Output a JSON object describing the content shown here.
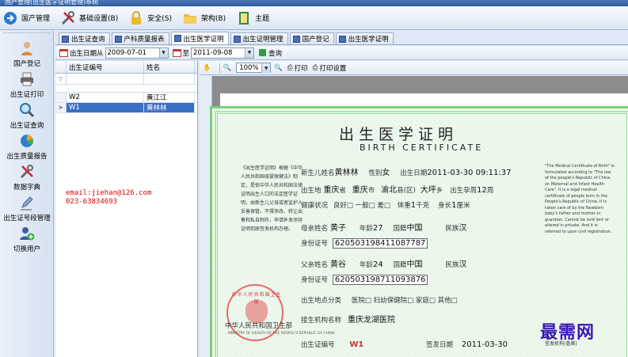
{
  "window": {
    "title": "国产管理(出生医学证明管理)系统"
  },
  "toolbar": [
    {
      "label": "国产管理",
      "icon": "arrow-circle-icon"
    },
    {
      "label": "基础设置(B)",
      "icon": "tools-icon"
    },
    {
      "label": "安全(S)",
      "icon": "padlock-icon"
    },
    {
      "label": "架构(B)",
      "icon": "folder-icon"
    },
    {
      "label": "主题",
      "icon": "theme-book-icon"
    }
  ],
  "sidebar": [
    {
      "label": "国产登记",
      "icon": "baby-icon"
    },
    {
      "label": "出生证打印",
      "icon": "printer-icon"
    },
    {
      "label": "出生证查询",
      "icon": "magnifier-icon"
    },
    {
      "label": "出生质量报告",
      "icon": "pie-chart-icon"
    },
    {
      "label": "数据字典",
      "icon": "tools-icon"
    },
    {
      "label": "出生证号段管理",
      "icon": "pen-icon"
    },
    {
      "label": "切换用户",
      "icon": "user-add-icon"
    }
  ],
  "tabs": [
    {
      "label": "出生证查询",
      "active": false
    },
    {
      "label": "产科质量报表",
      "active": false
    },
    {
      "label": "出生医学证明",
      "active": true
    },
    {
      "label": "出生证明管理",
      "active": false
    },
    {
      "label": "国产登记",
      "active": false
    },
    {
      "label": "出生医学证明",
      "active": false
    }
  ],
  "filter": {
    "date_from_label": "出生日期从",
    "date_from": "2009-07-01",
    "date_to_label": "至",
    "date_to": "2011-09-08",
    "query_label": "查询"
  },
  "grid": {
    "columns": [
      "出生证编号",
      "姓名"
    ],
    "filter_symbol": "▽",
    "rows": [
      {
        "id": "W2",
        "name": "黄江江",
        "selected": false,
        "marker": ""
      },
      {
        "id": "W1",
        "name": "黄林林",
        "selected": true,
        "marker": ">"
      }
    ]
  },
  "contact": {
    "email": "email:jiehan@126.com",
    "phone": "023-63834693"
  },
  "viewer": {
    "zoom": "100%",
    "print_label": "打印",
    "print_setup_label": "打印设置"
  },
  "certificate": {
    "title": "出生医学证明",
    "title_en": "BIRTH CERTIFICATE",
    "left_text": "《出生医学证明》根据《中华人民共和国母婴保健法》制定，是依中华人民共和国法律证明出生人口的法定医学证明，由新生儿父母或者监护人妥善保管。不得涂改、转让出售和私自制作，申请补发须持证明到原签发机构办理。",
    "right_text": "\"The Medical Certificate of Birth\" is formulated according to \"The law of the people's Republic of China on Maternal and Infant Health Care\". It is a legal medical certificate of people born in the People's Republic of China. It is taken care of by the Newborn baby's father and mother or guardian. Cannot be sold lent or altered in private. And it is referred to upon civil registration.",
    "newborn_label": "新生儿姓名",
    "newborn_name": "黄林林",
    "sex_label": "性别",
    "sex": "女",
    "birth_time_label": "出生日期",
    "birth_time": "2011-03-30 09:11:37",
    "birth_place_label": "出生地",
    "province": "重庆",
    "province_unit": "省",
    "city": "重庆",
    "city_unit": "市",
    "county": "渝北",
    "county_unit": "县(区)",
    "township": "大坪",
    "township_unit": "乡",
    "gestation_label": "出生孕周",
    "gestation_weeks": "12",
    "gestation_unit": "周",
    "health_label": "健康状况",
    "health_options": "良好□  一般□  差□",
    "weight_label": "体重",
    "weight": "1",
    "weight_unit": "千克",
    "height_label": "身长",
    "height": "1",
    "height_unit": "厘米",
    "mother_label": "母亲姓名",
    "mother_name": "黄子",
    "mother_age_label": "年龄",
    "mother_age": "27",
    "mother_nat_label": "国籍",
    "mother_nat": "中国",
    "mother_eth_label": "民族",
    "mother_eth": "汉",
    "mother_id_label": "身份证号",
    "mother_id": "620503198411087787",
    "father_label": "父亲姓名",
    "father_name": "黄谷",
    "father_age_label": "年龄",
    "father_age": "24",
    "father_nat_label": "国籍",
    "father_nat": "中国",
    "father_eth_label": "民族",
    "father_eth": "汉",
    "father_id_label": "身份证号",
    "father_id": "620503198711093876",
    "place_type_label": "出生地点分类",
    "place_type_options": "医院□  妇幼保健院□  家庭□  其他□",
    "agency_label": "接生机构名称",
    "agency": "重庆龙湖医院",
    "cert_no_label": "出生证编号",
    "cert_no": "W1",
    "issue_date_label": "签发日期",
    "issue_date": "2011-03-30",
    "issue_org_label": "签发机构(盖章)",
    "seal_text": "中华人民共和国卫生部",
    "ministry": "中华人民共和国卫生部",
    "ministry_en": "MINISTRY OF HEALTH OF THE PEOPLE'S REPUBLIC OF CHINA"
  },
  "watermark": "最需网"
}
